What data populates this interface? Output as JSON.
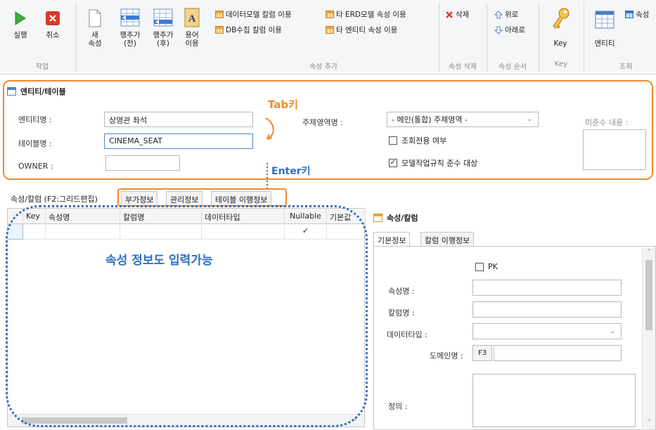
{
  "ribbon": {
    "run_label": "실행",
    "cancel_label": "취소",
    "group_work": "작업",
    "new_attr_label_1": "새",
    "new_attr_label_2": "속성",
    "row_add_before_1": "행추가",
    "row_add_before_2": "(전)",
    "row_add_after_1": "행추가",
    "row_add_after_2": "(후)",
    "term_use_1": "용어",
    "term_use_2": "이용",
    "datamodel_column_use": "데이터모델 칼럼 이용",
    "other_erd_attr_use": "타 ERD모델 속성 이용",
    "db_collect_column_use": "DB수집 칼럼 이용",
    "other_entity_attr_use": "타 엔티티 속성 이용",
    "group_attr_add": "속성 추가",
    "delete_label": "삭제",
    "group_attr_delete": "속성 삭제",
    "up_label": "위로",
    "down_label": "아래로",
    "group_attr_order": "속성 순서",
    "key_label": "Key",
    "group_key": "Key",
    "entity_label": "엔티티",
    "attr_label": "속성",
    "group_view": "조회"
  },
  "entity_panel": {
    "title": "엔티티/테이블",
    "entity_name_label": "엔티티명 :",
    "entity_name_value": "상영관 좌석",
    "table_name_label": "테이블명 :",
    "table_name_value": "CINEMA_SEAT",
    "owner_label": "OWNER :",
    "owner_value": "",
    "subject_area_label": "주제영역명 :",
    "subject_area_value": "- 메인(통합) 주제영역 -",
    "readonly_label": "조회전용 여부",
    "readonly_checked": false,
    "model_rule_label": "모델작업규칙 준수 대상",
    "model_rule_checked": true,
    "noncompliance_label": "미준수 내용 :"
  },
  "annotations": {
    "tab_key": "Tab키",
    "enter_key": "Enter키",
    "attr_input_note": "속성 정보도 입력가능",
    "orange": "#ef8a2a",
    "blue": "#2f6fc0"
  },
  "tabs": [
    {
      "label": "속성/칼럼 (F2:그리드편집)",
      "active": true
    },
    {
      "label": "부가정보",
      "active": false
    },
    {
      "label": "관리정보",
      "active": false
    },
    {
      "label": "테이블 이행정보",
      "active": false
    }
  ],
  "grid": {
    "columns": [
      "Key",
      "속성명",
      "칼럼명",
      "데이터타입",
      "Nullable",
      "기본값"
    ],
    "rows": [
      {
        "key": "",
        "attr": "",
        "column": "",
        "type": "",
        "nullable": "✓",
        "default": ""
      }
    ]
  },
  "attr_panel": {
    "title": "속성/칼럼",
    "tabs": [
      "기본정보",
      "칼럼 이행정보"
    ],
    "pk_label": "PK",
    "attr_name_label": "속성명 :",
    "column_name_label": "칼럼명 :",
    "datatype_label": "데이터타입 :",
    "domain_label": "도메인명 :",
    "domain_btn": "F3",
    "definition_label": "정의 :"
  }
}
